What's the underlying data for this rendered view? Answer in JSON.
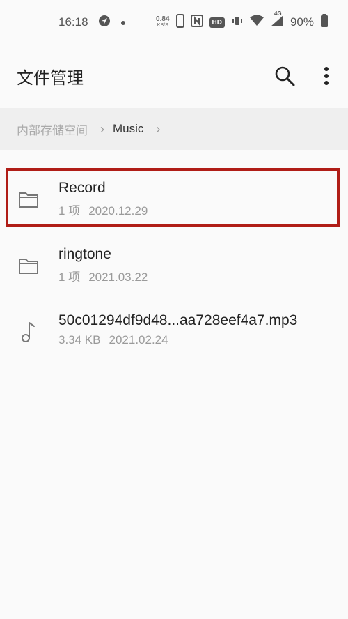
{
  "status_bar": {
    "time": "16:18",
    "net_speed_value": "0.84",
    "net_speed_unit": "KB/S",
    "hd_badge": "HD",
    "network_type": "4G",
    "battery": "90%"
  },
  "app_bar": {
    "title": "文件管理",
    "icons": [
      "search-icon",
      "more-vert-icon"
    ]
  },
  "breadcrumb": {
    "root": "内部存储空间",
    "current": "Music"
  },
  "files": [
    {
      "name": "Record",
      "detail": "1 项",
      "date": "2020.12.29",
      "icon": "folder-icon",
      "highlighted": true
    },
    {
      "name": "ringtone",
      "detail": "1 项",
      "date": "2021.03.22",
      "icon": "folder-icon",
      "highlighted": false
    },
    {
      "name": "50c01294df9d48...aa728eef4a7.mp3",
      "detail": "3.34 KB",
      "date": "2021.02.24",
      "icon": "music-note-icon",
      "highlighted": false
    }
  ],
  "colors": {
    "highlight_border": "#b01d17",
    "background": "#fafafa",
    "breadcrumb_bg": "#efefef"
  }
}
